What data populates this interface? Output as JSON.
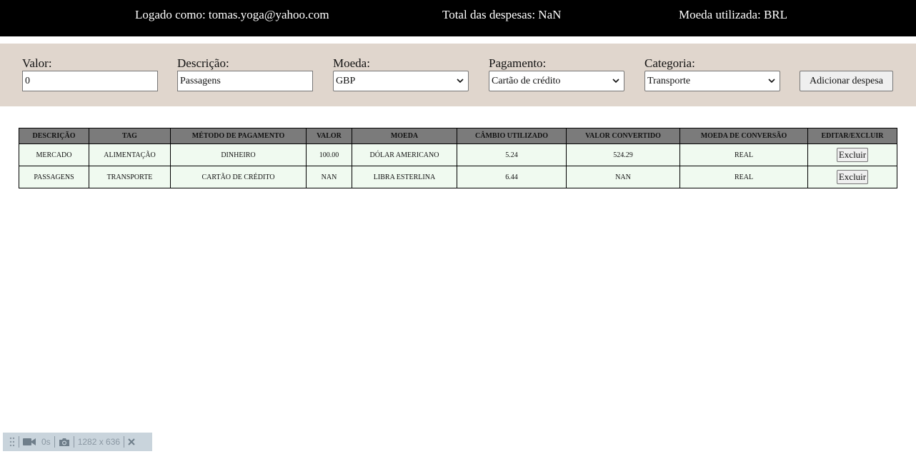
{
  "header": {
    "user_label": "Logado como: tomas.yoga@yahoo.com",
    "total_label": "Total das despesas: NaN",
    "currency_label": "Moeda utilizada: BRL"
  },
  "form": {
    "valor": {
      "label": "Valor:",
      "value": "0"
    },
    "descricao": {
      "label": "Descrição:",
      "value": "Passagens"
    },
    "moeda": {
      "label": "Moeda:",
      "value": "GBP"
    },
    "pagamento": {
      "label": "Pagamento:",
      "value": "Cartão de crédito"
    },
    "categoria": {
      "label": "Categoria:",
      "value": "Transporte"
    },
    "add_button": "Adicionar despesa"
  },
  "table": {
    "headers": [
      "Descrição",
      "Tag",
      "Método de pagamento",
      "Valor",
      "Moeda",
      "Câmbio utilizado",
      "Valor convertido",
      "Moeda de conversão",
      "Editar/Excluir"
    ],
    "rows": [
      [
        "Mercado",
        "Alimentação",
        "Dinheiro",
        "100.00",
        "Dólar Americano",
        "5.24",
        "524.29",
        "Real",
        "Excluir"
      ],
      [
        "Passagens",
        "Transporte",
        "Cartão de crédito",
        "NaN",
        "Libra Esterlina",
        "6.44",
        "NaN",
        "Real",
        "Excluir"
      ]
    ]
  },
  "recorder": {
    "time": "0s",
    "size": "1282 x 636",
    "icons": [
      "drag-handle-icon",
      "video-camera-icon",
      "camera-icon",
      "close-icon"
    ]
  }
}
